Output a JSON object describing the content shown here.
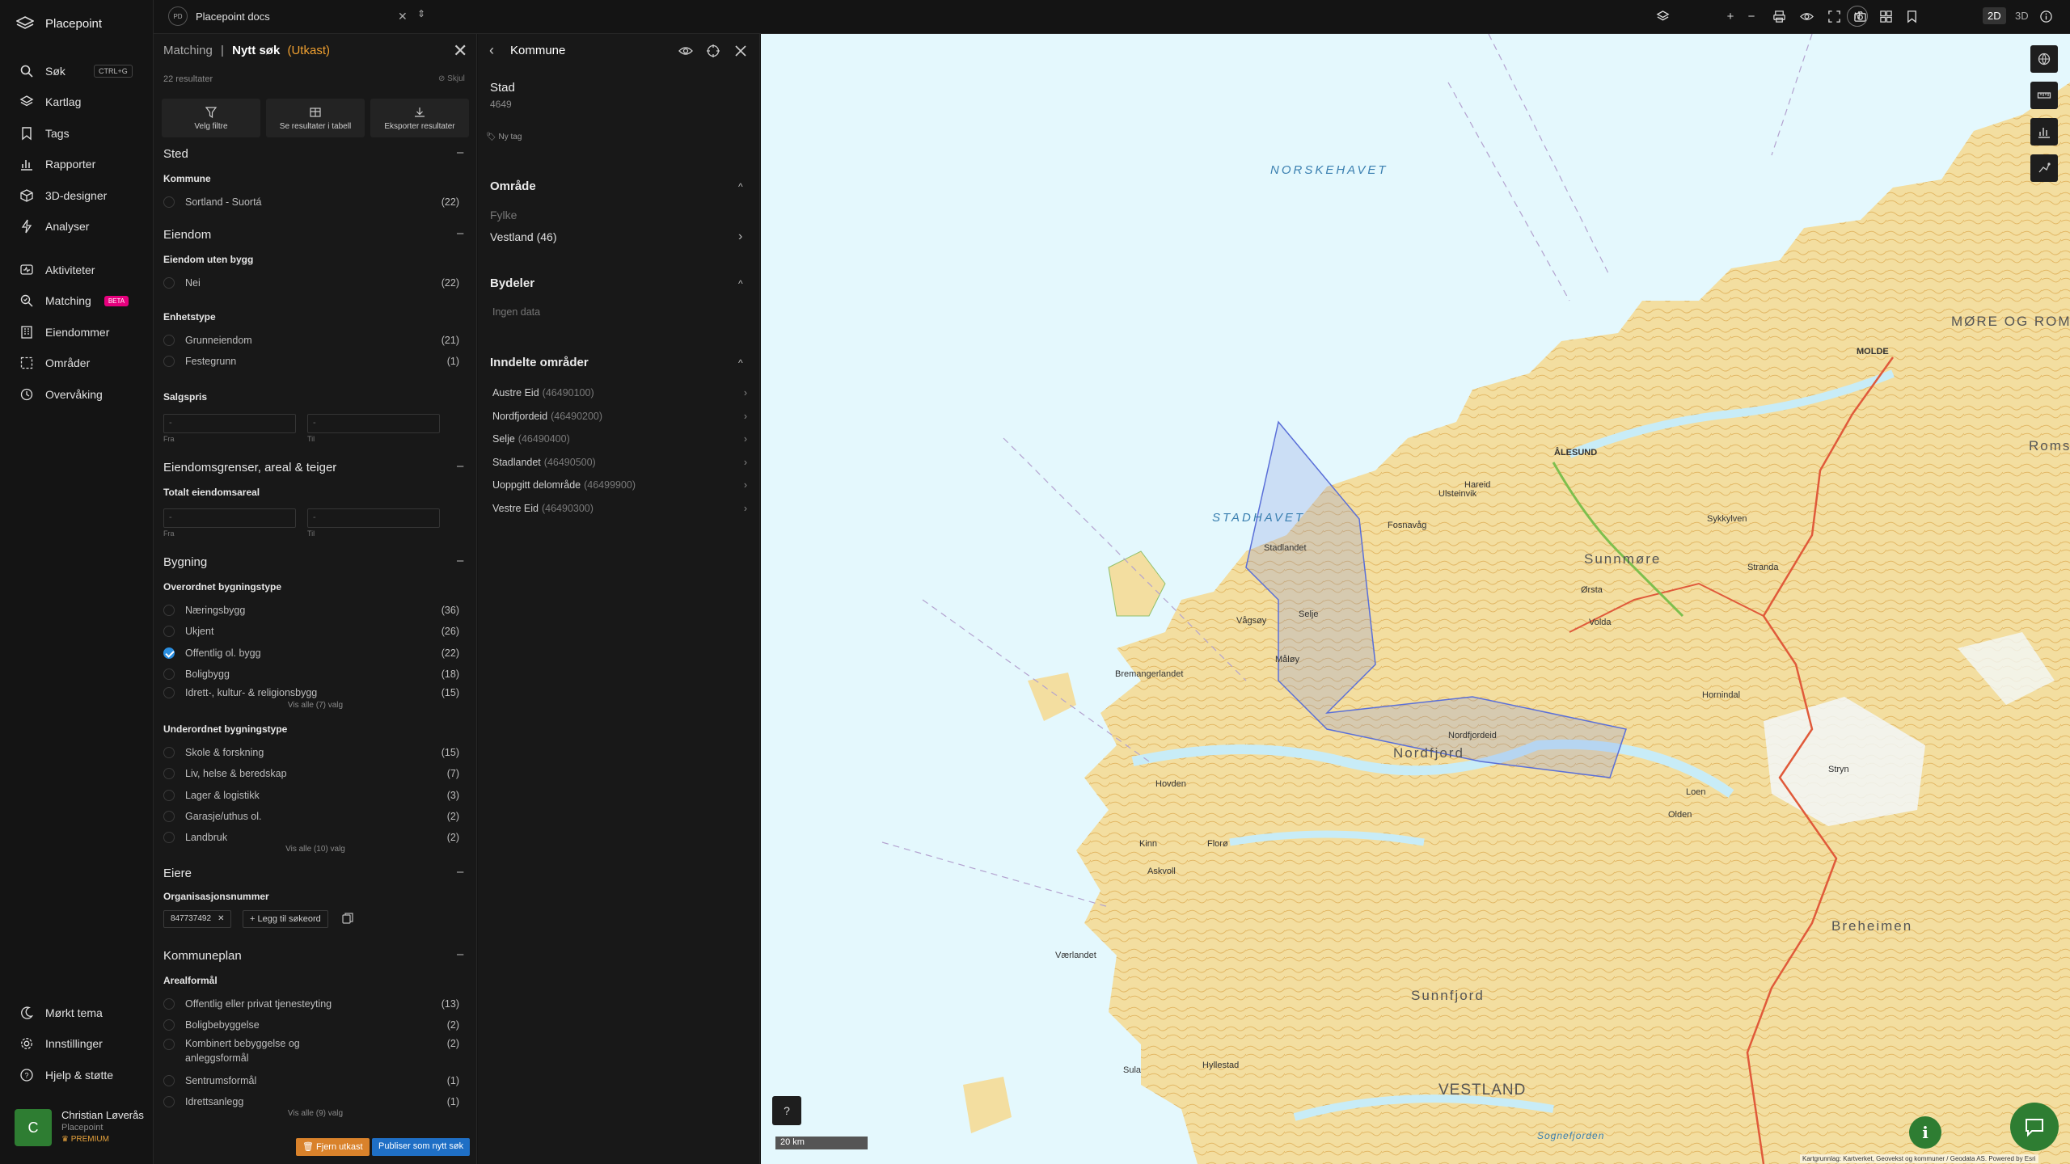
{
  "app": {
    "name": "Placepoint"
  },
  "nav": {
    "search_label": "Søk",
    "search_shortcut": "CTRL+G",
    "items_top": [
      "Kartlag",
      "Tags",
      "Rapporter",
      "3D-designer",
      "Analyser"
    ],
    "items_mid": [
      "Aktiviteter",
      "Matching",
      "Eiendommer",
      "Områder",
      "Overvåking"
    ],
    "matching_badge": "BETA",
    "items_bottom": [
      "Mørkt tema",
      "Innstillinger",
      "Hjelp & støtte"
    ]
  },
  "user": {
    "initial": "C",
    "name": "Christian Løverås",
    "org": "Placepoint",
    "plan": "PREMIUM"
  },
  "workspace": {
    "badge": "PD",
    "name": "Placepoint docs"
  },
  "toolbar": {
    "north": "N",
    "dim_2d": "2D",
    "dim_3d": "3D"
  },
  "filter": {
    "crumb": "Matching",
    "sep": "|",
    "title": "Nytt søk",
    "status": "(Utkast)",
    "results": "22 resultater",
    "hide": "Skjul",
    "actions": [
      "Velg filtre",
      "Se resultater i tabell",
      "Eksporter resultater"
    ],
    "sections": {
      "sted": "Sted",
      "eiendom": "Eiendom",
      "grenser": "Eiendomsgrenser, areal & teiger",
      "bygning": "Bygning",
      "eiere": "Eiere",
      "kommuneplan": "Kommuneplan"
    },
    "sub": {
      "kommune": "Kommune",
      "uten_bygg": "Eiendom uten bygg",
      "enhetstype": "Enhetstype",
      "salgspris": "Salgspris",
      "totalt_areal": "Totalt eiendomsareal",
      "overordnet": "Overordnet bygningstype",
      "underordnet": "Underordnet bygningstype",
      "orgnr": "Organisasjonsnummer",
      "arealformal": "Arealformål"
    },
    "kommune_opts": [
      {
        "label": "Sortland - Suortá",
        "count": "(22)"
      }
    ],
    "uten_bygg_opts": [
      {
        "label": "Nei",
        "count": "(22)"
      }
    ],
    "enhetstype_opts": [
      {
        "label": "Grunneiendom",
        "count": "(21)"
      },
      {
        "label": "Festegrunn",
        "count": "(1)"
      }
    ],
    "range": {
      "placeholder": "-",
      "from": "Fra",
      "to": "Til"
    },
    "overordnet_opts": [
      {
        "label": "Næringsbygg",
        "count": "(36)"
      },
      {
        "label": "Ukjent",
        "count": "(26)"
      },
      {
        "label": "Offentlig ol. bygg",
        "count": "(22)",
        "checked": true
      },
      {
        "label": "Boligbygg",
        "count": "(18)"
      },
      {
        "label": "Idrett-, kultur- & religionsbygg",
        "count": "(15)"
      }
    ],
    "overordnet_more": "Vis alle (7) valg",
    "underordnet_opts": [
      {
        "label": "Skole & forskning",
        "count": "(15)"
      },
      {
        "label": "Liv, helse & beredskap",
        "count": "(7)"
      },
      {
        "label": "Lager & logistikk",
        "count": "(3)"
      },
      {
        "label": "Garasje/uthus ol.",
        "count": "(2)"
      },
      {
        "label": "Landbruk",
        "count": "(2)"
      }
    ],
    "underordnet_more": "Vis alle (10) valg",
    "orgnr_chip": "847737492",
    "add_keyword": "Legg til søkeord",
    "arealformal_opts": [
      {
        "label": "Offentlig eller privat tjenesteyting",
        "count": "(13)"
      },
      {
        "label": "Boligbebyggelse",
        "count": "(2)"
      },
      {
        "label": "Kombinert bebyggelse og anleggsformål",
        "count": "(2)"
      },
      {
        "label": "Sentrumsformål",
        "count": "(1)"
      },
      {
        "label": "Idrettsanlegg",
        "count": "(1)"
      }
    ],
    "arealformal_more": "Vis alle (9) valg",
    "btn_remove": "Fjern utkast",
    "btn_publish": "Publiser som nytt søk"
  },
  "kommune": {
    "header": "Kommune",
    "name": "Stad",
    "number": "4649",
    "new_tag": "Ny tag",
    "omrade": {
      "title": "Område",
      "fylke_label": "Fylke",
      "fylke_value": "Vestland (46)"
    },
    "bydeler": {
      "title": "Bydeler",
      "empty": "Ingen data"
    },
    "inndelte": {
      "title": "Inndelte områder",
      "items": [
        {
          "name": "Austre Eid",
          "code": "(46490100)"
        },
        {
          "name": "Nordfjordeid",
          "code": "(46490200)"
        },
        {
          "name": "Selje",
          "code": "(46490400)"
        },
        {
          "name": "Stadlandet",
          "code": "(46490500)"
        },
        {
          "name": "Uoppgitt delområde",
          "code": "(46499900)"
        },
        {
          "name": "Vestre Eid",
          "code": "(46490300)"
        }
      ]
    }
  },
  "map": {
    "labels": {
      "norskehavet": "NORSKEHAVET",
      "stadhavet": "STADHAVET",
      "more": "MØRE OG ROMSDAL",
      "sunnmore": "Sunnmøre",
      "nordfjord": "Nordfjord",
      "sunnfjord": "Sunnfjord",
      "vestland": "VESTLAND",
      "breheimen": "Breheimen",
      "romsdal": "Romsdal",
      "alesund": "ÅLESUND",
      "molde": "MOLDE",
      "stadlandet": "Stadlandet",
      "selje": "Selje",
      "maloy": "Måløy",
      "bremanger": "Bremangerlandet",
      "florø": "Florø",
      "volda": "Volda",
      "orsta": "Ørsta",
      "stryn": "Stryn",
      "vagsoy": "Vågsøy",
      "nordfjordeid": "Nordfjordeid",
      "fosnavag": "Fosnavåg",
      "ulsteinvik": "Ulsteinvik",
      "sognefjorden": "Sognefjorden",
      "hovden": "Hovden",
      "kinn": "Kinn",
      "askvoll": "Askvoll",
      "vaerlandet": "Værlandet",
      "hareid": "Hareid",
      "sykkylven": "Sykkylven",
      "stranda": "Stranda",
      "loen": "Loen",
      "olden": "Olden",
      "hornindal": "Hornindal",
      "hyllestad": "Hyllestad",
      "sula": "Sula"
    },
    "scale": "20 km",
    "help": "?",
    "attribution": "Kartgrunnlag: Kartverket, Geovekst og kommuner / Geodata AS. Powered by Esri"
  },
  "colors": {
    "accent": "#2a8ee0",
    "draft": "#f0a030",
    "publish": "#1f6fc5",
    "remove": "#d9822b",
    "beta": "#e6007e",
    "green": "#2e7d32"
  }
}
